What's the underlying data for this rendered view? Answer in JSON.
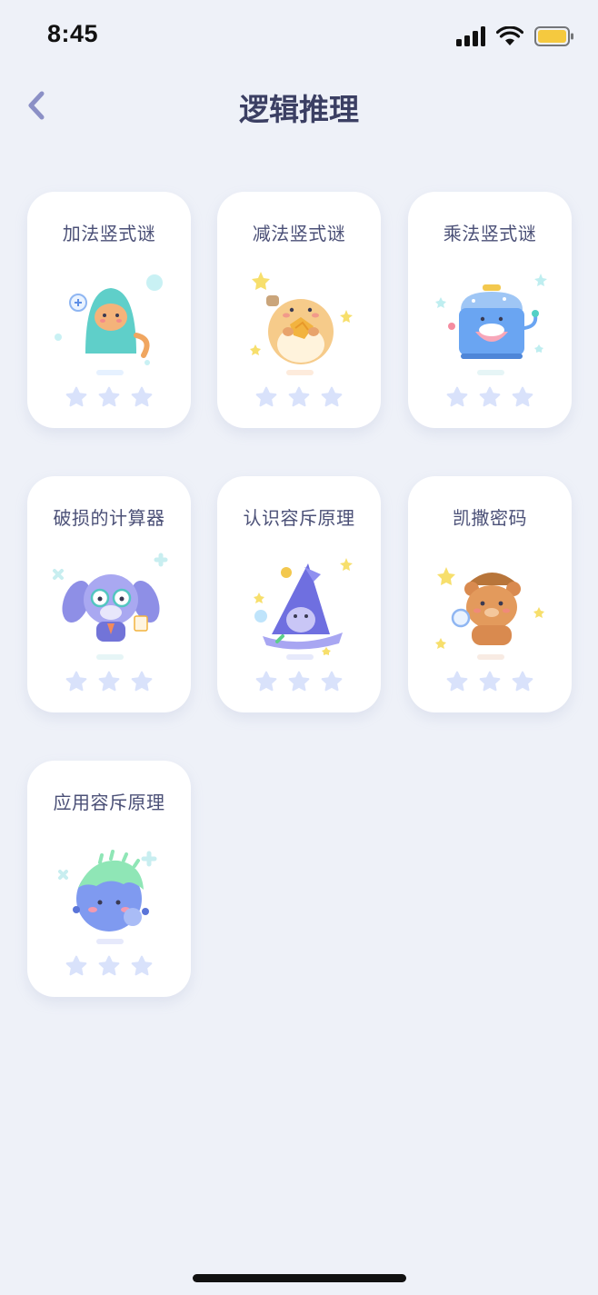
{
  "status": {
    "time": "8:45"
  },
  "header": {
    "title": "逻辑推理"
  },
  "cards": [
    {
      "title": "加法竖式谜",
      "stars": 0,
      "character": "teal-ghost-cat"
    },
    {
      "title": "减法竖式谜",
      "stars": 0,
      "character": "hamster"
    },
    {
      "title": "乘法竖式谜",
      "stars": 0,
      "character": "rice-cooker"
    },
    {
      "title": "破损的计算器",
      "stars": 0,
      "character": "purple-dog"
    },
    {
      "title": "认识容斥原理",
      "stars": 0,
      "character": "wizard"
    },
    {
      "title": "凯撒密码",
      "stars": 0,
      "character": "detective-bear"
    },
    {
      "title": "应用容斥原理",
      "stars": 0,
      "character": "planet"
    }
  ],
  "colors": {
    "background": "#eef1f8",
    "title": "#3b3f63",
    "card_text": "#4b5077",
    "star_empty": "#d9e2fb",
    "back_arrow": "#8b90c6",
    "battery": "#f5c93f"
  }
}
